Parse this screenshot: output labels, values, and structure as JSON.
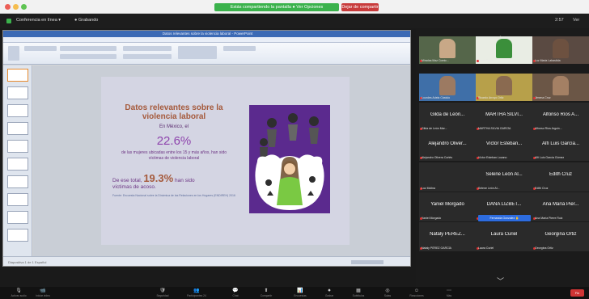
{
  "top_bar": {
    "share_status": "Estás compartiendo la pantalla ● Ver Opciones",
    "stop_share": "Dejar de compartir"
  },
  "zoom_header": {
    "meeting_title": "Conferencia en línea ▾",
    "record": "● Grabando",
    "clock": "2:57",
    "view": "Ver"
  },
  "ppt": {
    "title": "Datos relevantes sobre la violencia laboral - PowerPoint",
    "status": "Diapositiva 1 de 1   Español"
  },
  "slide": {
    "heading": "Datos relevantes sobre la violencia laboral",
    "mexico": "En México, el",
    "pct": "22.6%",
    "body": "de las mujeres ubicadas entre los 15 y más años, han sido víctimas de violencia laboral",
    "total_pre": "De ese total,",
    "total_num": "19.3%",
    "total_post": "han sido",
    "total_line2": "víctimas de acoso.",
    "reference": "Fuente: Encuesta Nacional sobre la Dinámica de las Relaciones en los Hogares (ENDIREH) 2016"
  },
  "video_tiles": [
    {
      "sub": "Miradas Maz Comic...",
      "color": "#55664a",
      "face": "#c8a887"
    },
    {
      "sub": "Toros Conts",
      "color": "#e9ede4",
      "face": "#3b8f3b"
    },
    {
      "sub": "Luz Maria Labastida",
      "color": "#5a4a42",
      "face": "#6d5140"
    },
    {
      "sub": "Lourdes Adela Cástulo",
      "color": "#3f6fa8",
      "face": "#9c7a62"
    },
    {
      "sub": "Ricardo Arroyo Ortiz",
      "color": "#b7a04a",
      "face": "#8a6a50"
    },
    {
      "sub": "Jimena Cruz",
      "color": "#6b5646",
      "face": "#a48064"
    }
  ],
  "name_tiles": [
    {
      "name": "Gilda de León...",
      "sub": "Gilda de León Mar..."
    },
    {
      "name": "MARTHA SILVI...",
      "sub": "MARTHA SILVIA GARCÍA"
    },
    {
      "name": "Alfonso Ríos A...",
      "sub": "Alfonso Ríos Arguin..."
    },
    {
      "name": "Alejandro Oliver...",
      "sub": "Alejandro Olivera Cortés"
    },
    {
      "name": "Víctor Esteban...",
      "sub": "Víctor Esteban Lozano"
    },
    {
      "name": "Alfí Luis García...",
      "sub": "Alfí Luis García Gómez"
    },
    {
      "name": "",
      "sub": "Luz Molina"
    },
    {
      "name": "Selene León Al...",
      "sub": "Selene León Al..."
    },
    {
      "name": "Edith Cruz",
      "sub": "Edith Cruz"
    },
    {
      "name": "Yaniel Morgado",
      "sub": "Yaniel Morgado"
    },
    {
      "name": "DANA LIZBET...",
      "sub": "DANA LIZBETH ROJAS"
    },
    {
      "name": "Ana María Pier...",
      "sub": "Ana María Pierre Ruiz"
    },
    {
      "name": "Nataly PÉREZ...",
      "sub": "Nataly PÉREZ GARCÍA"
    },
    {
      "name": "Laura Curiel",
      "sub": "Laura Curiel"
    },
    {
      "name": "Georgina Ortiz",
      "sub": "Georgina Ortiz"
    }
  ],
  "raised_hand": "Fernanda Gonzalez ✋",
  "toolbar": [
    {
      "icon": "🎙",
      "label": "Activar audio"
    },
    {
      "icon": "📹",
      "label": "Iniciar video"
    },
    {
      "icon": "🛡",
      "label": "Seguridad"
    },
    {
      "icon": "👥",
      "label": "Participantes 24"
    },
    {
      "icon": "💬",
      "label": "Chat"
    },
    {
      "icon": "⬆",
      "label": "Compartir"
    },
    {
      "icon": "📊",
      "label": "Encuestas"
    },
    {
      "icon": "⏺",
      "label": "Grabar"
    },
    {
      "icon": "▦",
      "label": "Subtítulos"
    },
    {
      "icon": "◎",
      "label": "Salas"
    },
    {
      "icon": "☺",
      "label": "Reacciones"
    },
    {
      "icon": "⋯",
      "label": "Más"
    }
  ],
  "end_label": "Fin",
  "colors": {
    "share_green": "#3bb24c",
    "end_red": "#d03535",
    "slide_purple": "#5b2a8e",
    "heading_brown": "#a55a3c"
  }
}
